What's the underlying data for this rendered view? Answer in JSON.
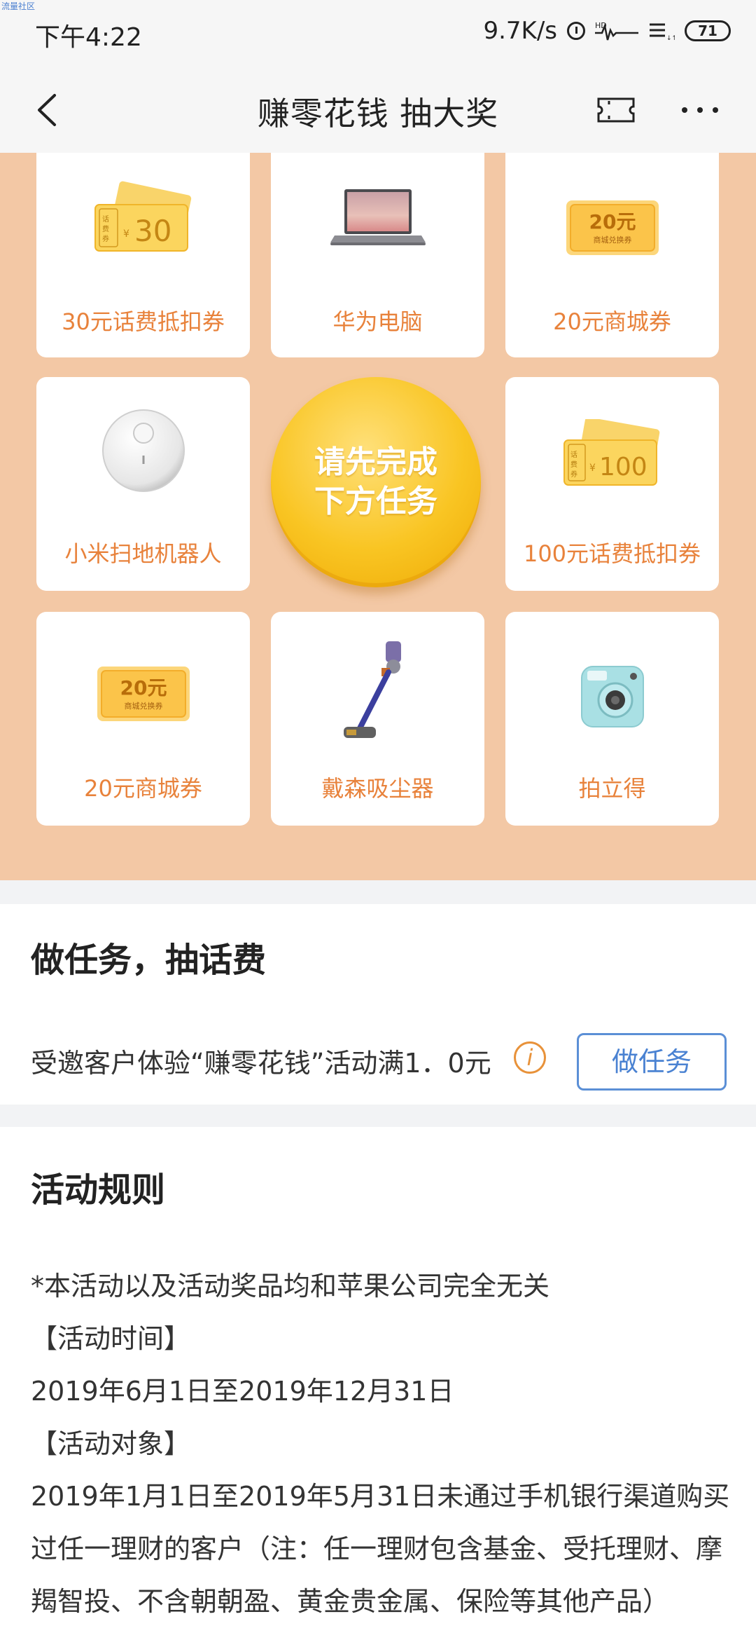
{
  "status_bar": {
    "watermark": "流量社区",
    "time": "下午4:22",
    "network_speed": "9.7K/s",
    "battery": "71"
  },
  "nav": {
    "title": "赚零花钱 抽大奖",
    "icons": [
      "back-icon",
      "ticket-icon",
      "more-icon"
    ]
  },
  "prizes": [
    {
      "label": "30元话费抵扣券",
      "icon": "phone-coupon-30-icon"
    },
    {
      "label": "华为电脑",
      "icon": "laptop-icon"
    },
    {
      "label": "20元商城券",
      "icon": "mall-coupon-20-icon"
    },
    {
      "label": "小米扫地机器人",
      "icon": "robot-vacuum-icon"
    },
    {
      "label": "100元话费抵扣券",
      "icon": "phone-coupon-100-icon"
    },
    {
      "label": "20元商城券",
      "icon": "mall-coupon-20-icon"
    },
    {
      "label": "戴森吸尘器",
      "icon": "vacuum-cleaner-icon"
    },
    {
      "label": "拍立得",
      "icon": "instant-camera-icon"
    }
  ],
  "coupon_text": {
    "phone_small": "话费券",
    "yen": "¥",
    "value_30": "30",
    "value_100": "100",
    "mall_value": "20元",
    "mall_sub": "商城兑换券"
  },
  "draw_button": "请先完成下方任务",
  "task": {
    "title": "做任务，抽话费",
    "description": "受邀客户体验“赚零花钱”活动满1．0元",
    "button": "做任务"
  },
  "rules": {
    "title": "活动规则",
    "lines": [
      "*本活动以及活动奖品均和苹果公司完全无关",
      "【活动时间】",
      "2019年6月1日至2019年12月31日",
      "【活动对象】",
      "2019年1月1日至2019年5月31日未通过手机银行渠道购买过任一理财的客户（注：任一理财包含基金、受托理财、摩羯智投、不含朝朝盈、黄金贵金属、保险等其他产品）"
    ]
  },
  "colors": {
    "prize_bg": "#f3c8a5",
    "prize_label": "#e8823b",
    "draw_button": "#f9c523",
    "task_button_border": "#5b8fd6"
  }
}
